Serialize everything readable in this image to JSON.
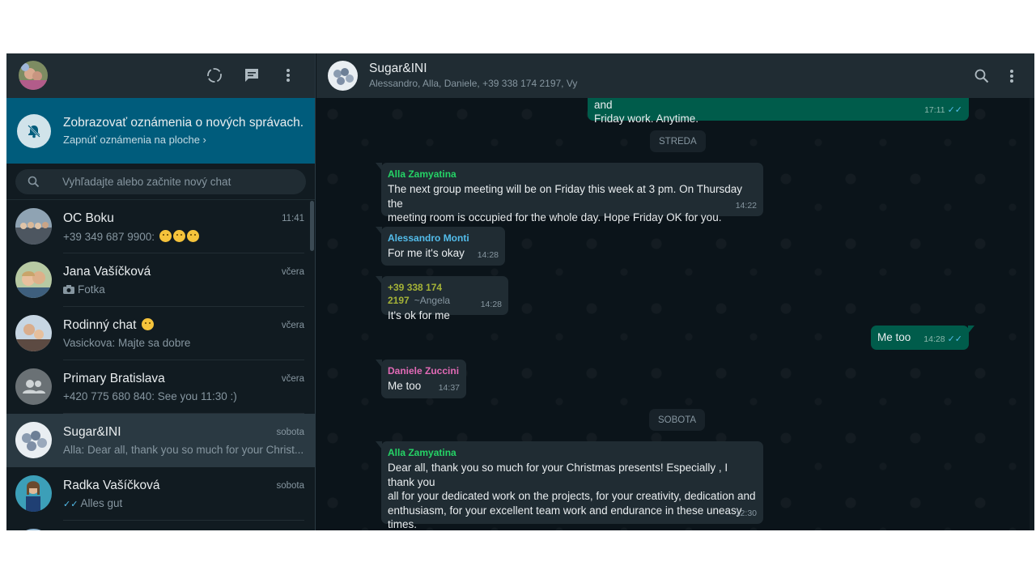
{
  "sidebar": {
    "icons": {
      "status": "status-icon",
      "new_chat": "new-chat-icon",
      "menu": "menu-icon"
    },
    "notification": {
      "title": "Zobrazovať oznámenia o nových správach.",
      "link": "Zapnúť oznámenia na ploche ›"
    },
    "search": {
      "placeholder": "Vyhľadajte alebo začnite nový chat"
    },
    "chats": [
      {
        "name": "OC Boku",
        "time": "11:41",
        "preview": "+39 349 687 9900: "
      },
      {
        "name": "Jana Vašíčková",
        "time": "včera",
        "preview": "Fotka"
      },
      {
        "name": "Rodinný chat ",
        "time": "včera",
        "preview": "Vasickova: Majte sa dobre"
      },
      {
        "name": "Primary Bratislava",
        "time": "včera",
        "preview": "+420 775 680 840: See you 11:30 :)"
      },
      {
        "name": "Sugar&INI",
        "time": "sobota",
        "preview": "Alla: Dear all, thank you so much for your Christ..."
      },
      {
        "name": "Radka Vašíčková",
        "time": "sobota",
        "preview": "Alles gut"
      }
    ]
  },
  "chat": {
    "header": {
      "name": "Sugar&INI",
      "members": "Alessandro, Alla, Daniele, +39 338 174 2197, Vy"
    },
    "messages": {
      "m0": {
        "text": "PS for next Thursday - my class got rescheduled, so both days Thursday and\nFriday work. Anytime.",
        "time": "17:11"
      },
      "sep1": "STREDA",
      "m1": {
        "sender": "Alla Zamyatina",
        "text": "The next group meeting will be on Friday this week at 3 pm. On  Thursday the\nmeeting room is occupied for the whole day. Hope Friday OK for you.",
        "time": "14:22"
      },
      "m2": {
        "sender": "Alessandro Monti",
        "text": "For me it's okay",
        "time": "14:28"
      },
      "m3": {
        "sender": "+39 338 174 2197",
        "alias": "~Angela",
        "text": "It's ok for me",
        "time": "14:28"
      },
      "m4": {
        "text": "Me too",
        "time": "14:28"
      },
      "m5": {
        "sender": "Daniele Zuccini",
        "text": "Me too",
        "time": "14:37"
      },
      "sep2": "SOBOTA",
      "m6": {
        "sender": "Alla Zamyatina",
        "text": "Dear all, thank you so much for your Christmas presents! Especially , I thank you\nall for your dedicated work on the projects, for your creativity,  dedication and\nenthusiasm,  for your excellent team work and endurance in these uneasy times.\nI wish you all health, happiness and success in the coming year. Alla",
        "time": "12:30"
      }
    }
  },
  "colors": {
    "app_bg": "#0b141a",
    "panel": "#202c33",
    "banner": "#005c7c",
    "outgoing": "#005c4b",
    "incoming": "#202c33",
    "alla": "#25d366",
    "alessandro": "#53bdeb",
    "angela": "#a5b337",
    "daniele": "#e26ab6"
  }
}
